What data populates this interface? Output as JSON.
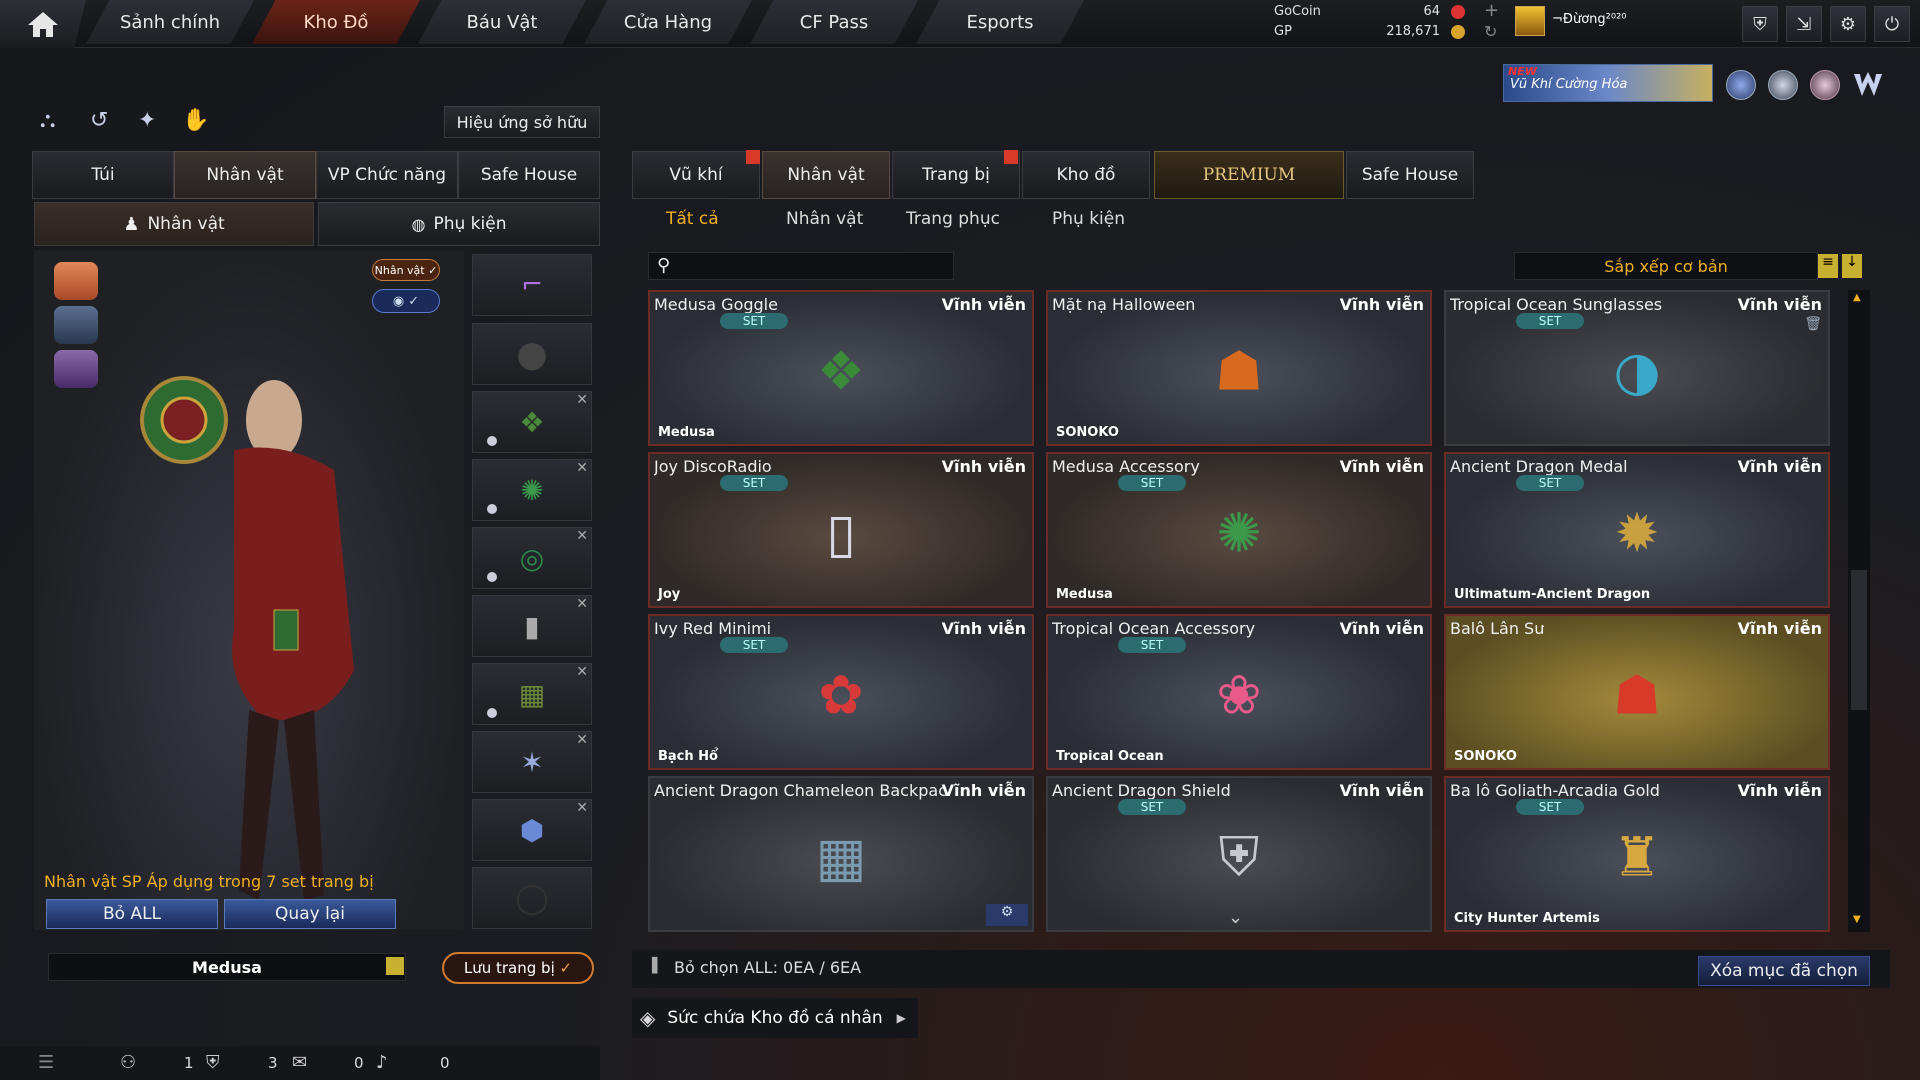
{
  "nav": {
    "tabs": [
      "Sảnh chính",
      "Kho Đồ",
      "Báu Vật",
      "Cửa Hàng",
      "CF Pass",
      "Esports"
    ],
    "active": "Kho Đồ"
  },
  "currency": {
    "gocoin_label": "GoCoin",
    "gocoin_value": "64",
    "gp_label": "GP",
    "gp_value": "218,671"
  },
  "user": {
    "name": "¬Đừơng²⁰²⁰"
  },
  "promo": {
    "new_badge": "NEW",
    "text": "Vũ Khí Cường Hóa"
  },
  "left": {
    "effect_button": "Hiệu ứng sở hữu",
    "tabs": [
      "Túi",
      "Nhân vật",
      "VP Chức năng",
      "Safe House"
    ],
    "subtabs": [
      "Nhân vật",
      "Phụ kiện"
    ],
    "badge_character": "Nhân vật",
    "notice": "Nhân vật SP Áp dụng trong 7 set trang bị",
    "remove_all": "Bỏ ALL",
    "back": "Quay lại",
    "character_name": "Medusa",
    "save_equip": "Lưu trang bị"
  },
  "right": {
    "tabs": [
      "Vũ khí",
      "Nhân vật",
      "Trang bị",
      "Kho đồ",
      "PREMIUM",
      "Safe House"
    ],
    "subtabs": [
      "Tất cả",
      "Nhân vật",
      "Trang phục",
      "Phụ kiện"
    ],
    "sort_label": "Sắp xếp cơ bản",
    "search_placeholder": "",
    "select_all": "Bỏ chọn ALL: 0EA / 6EA",
    "delete_selected": "Xóa mục đã chọn",
    "capacity": "Sức chứa Kho đồ cá nhân"
  },
  "items": [
    {
      "name": "Medusa Goggle",
      "perm": "Vĩnh viễn",
      "set": "SET",
      "owner": "Medusa",
      "style": "normal"
    },
    {
      "name": "Mặt nạ Halloween",
      "perm": "Vĩnh viễn",
      "set": "",
      "owner": "SONOKO",
      "style": "normal"
    },
    {
      "name": "Tropical Ocean Sunglasses",
      "perm": "Vĩnh viễn",
      "set": "SET",
      "owner": "",
      "style": "gray"
    },
    {
      "name": "Joy DiscoRadio",
      "perm": "Vĩnh viễn",
      "set": "SET",
      "owner": "Joy",
      "style": "brown"
    },
    {
      "name": "Medusa Accessory",
      "perm": "Vĩnh viễn",
      "set": "SET",
      "owner": "Medusa",
      "style": "brown"
    },
    {
      "name": "Ancient Dragon Medal",
      "perm": "Vĩnh viễn",
      "set": "SET",
      "owner": "Ultimatum-Ancient Dragon",
      "style": "normal"
    },
    {
      "name": "Ivy Red Minimi",
      "perm": "Vĩnh viễn",
      "set": "SET",
      "owner": "Bạch Hổ",
      "style": "normal"
    },
    {
      "name": "Tropical Ocean Accessory",
      "perm": "Vĩnh viễn",
      "set": "SET",
      "owner": "Tropical Ocean",
      "style": "normal"
    },
    {
      "name": "Balô Lân Sư",
      "perm": "Vĩnh viễn",
      "set": "",
      "owner": "SONOKO",
      "style": "gold"
    },
    {
      "name": "Ancient Dragon Chameleon Backpack",
      "perm": "Vĩnh viễn",
      "set": "",
      "owner": "",
      "style": "gray"
    },
    {
      "name": "Ancient Dragon Shield",
      "perm": "Vĩnh viễn",
      "set": "SET",
      "owner": "",
      "style": "gray"
    },
    {
      "name": "Ba lô Goliath-Arcadia Gold",
      "perm": "Vĩnh viễn",
      "set": "SET",
      "owner": "City Hunter Artemis",
      "style": "normal"
    }
  ],
  "status": {
    "friends": "1",
    "clan": "3",
    "chat": "0",
    "voice": "0"
  }
}
